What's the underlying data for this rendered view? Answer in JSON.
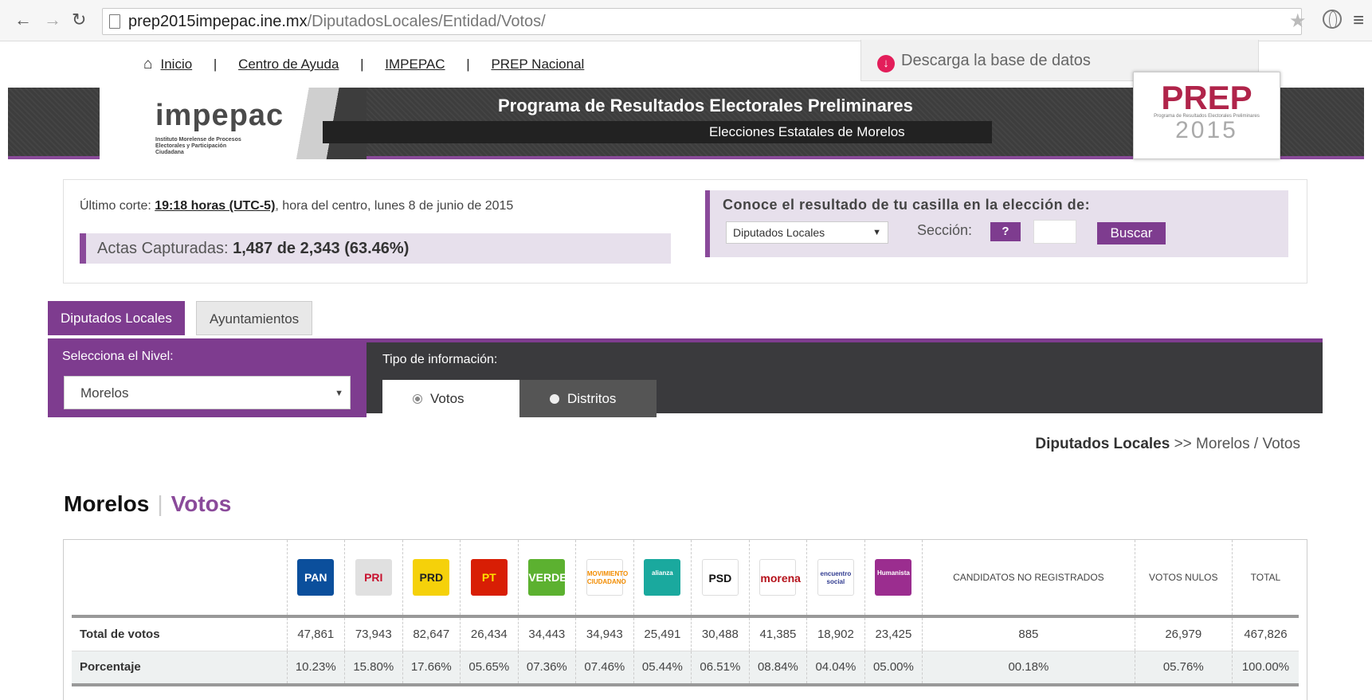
{
  "browser": {
    "url_host": "prep2015impepac.ine.mx",
    "url_path": "/DiputadosLocales/Entidad/Votos/"
  },
  "toplinks": [
    "Inicio",
    "Centro de Ayuda",
    "IMPEPAC",
    "PREP Nacional"
  ],
  "download_label": "Descarga la base de datos",
  "banner": {
    "logo": "impepac",
    "logo_sub": "Instituto Morelense de Procesos Electorales y Participación Ciudadana",
    "title": "Programa de Resultados Electorales Preliminares",
    "subtitle": "Elecciones Estatales de Morelos",
    "prep_word": "PREP",
    "prep_tiny": "Programa de Resultados Electorales Preliminares",
    "prep_year": "2015"
  },
  "corte": {
    "prefix": "Último corte: ",
    "time": "19:18 horas (UTC-5)",
    "suffix": ", hora del centro, lunes 8 de junio de 2015"
  },
  "actas": {
    "label": "Actas Capturadas: ",
    "value": "1,487 de 2,343 (63.46%)"
  },
  "casilla": {
    "title": "Conoce el resultado de tu casilla en la elección de:",
    "select_value": "Diputados Locales",
    "seccion_label": "Sección:",
    "help": "?",
    "buscar": "Buscar"
  },
  "tabs": [
    "Diputados Locales",
    "Ayuntamientos"
  ],
  "panel": {
    "nivel_label": "Selecciona el Nivel:",
    "nivel_value": "Morelos",
    "tipo_label": "Tipo de información:",
    "options": [
      "Votos",
      "Distritos"
    ]
  },
  "breadcrumb": {
    "strong": "Diputados Locales",
    "rest": " >> Morelos / Votos"
  },
  "title": {
    "main": "Morelos",
    "sep": "|",
    "sub": "Votos"
  },
  "table": {
    "parties": [
      {
        "name": "PAN",
        "color": "#0b4f9c",
        "text": "#ffffff"
      },
      {
        "name": "PRI",
        "color": "#e0e0e0",
        "text": "#c8102e"
      },
      {
        "name": "PRD",
        "color": "#f5d10a",
        "text": "#222222"
      },
      {
        "name": "PT",
        "color": "#d81e05",
        "text": "#ffe000"
      },
      {
        "name": "VERDE",
        "color": "#5cb130",
        "text": "#ffffff"
      },
      {
        "name": "MOVIMIENTO CIUDADANO",
        "color": "#ffffff",
        "text": "#f28c00"
      },
      {
        "name": "alianza",
        "color": "#1aa99e",
        "text": "#ffffff"
      },
      {
        "name": "PSD",
        "color": "#ffffff",
        "text": "#111111"
      },
      {
        "name": "morena",
        "color": "#ffffff",
        "text": "#b5121b"
      },
      {
        "name": "encuentro social",
        "color": "#ffffff",
        "text": "#2f3a8f"
      },
      {
        "name": "Humanista",
        "color": "#9b2d8f",
        "text": "#ffffff"
      }
    ],
    "extra_headers": [
      "CANDIDATOS NO REGISTRADOS",
      "VOTOS NULOS",
      "TOTAL"
    ],
    "rows": [
      {
        "label": "Total de votos",
        "values": [
          "47,861",
          "73,943",
          "82,647",
          "26,434",
          "34,443",
          "34,943",
          "25,491",
          "30,488",
          "41,385",
          "18,902",
          "23,425",
          "885",
          "26,979",
          "467,826"
        ]
      },
      {
        "label": "Porcentaje",
        "values": [
          "10.23%",
          "15.80%",
          "17.66%",
          "05.65%",
          "07.36%",
          "07.46%",
          "05.44%",
          "06.51%",
          "08.84%",
          "04.04%",
          "05.00%",
          "00.18%",
          "05.76%",
          "100.00%"
        ]
      }
    ]
  }
}
